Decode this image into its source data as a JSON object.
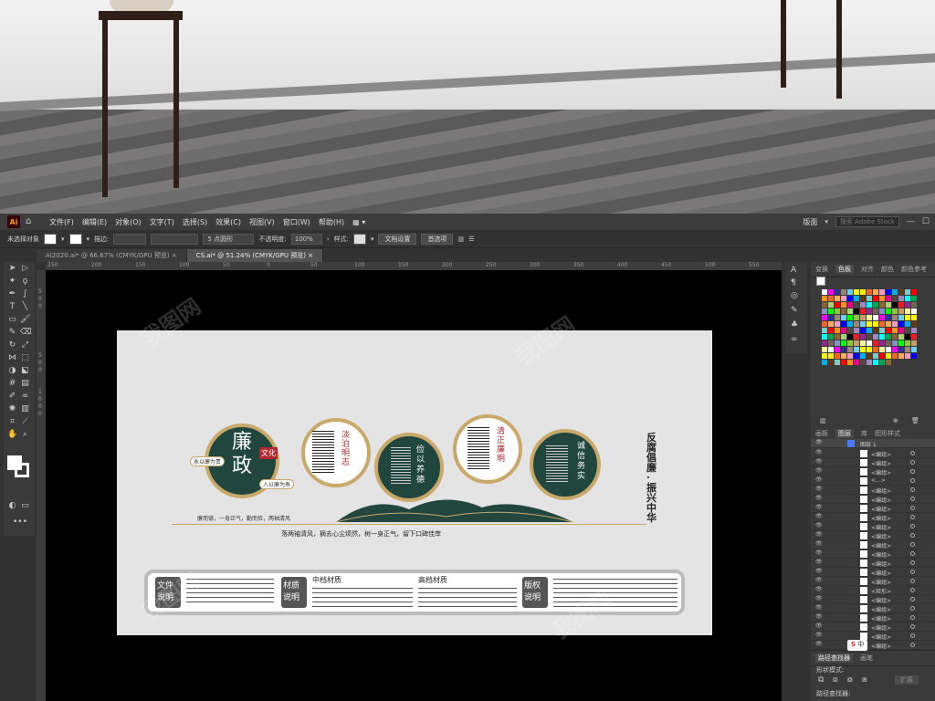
{
  "menubar": {
    "app_badge": "Ai",
    "items": [
      "文件(F)",
      "编辑(E)",
      "对象(O)",
      "文字(T)",
      "选择(S)",
      "效果(C)",
      "视图(V)",
      "窗口(W)",
      "帮助(H)"
    ],
    "workspace": "版面",
    "search_placeholder": "搜索 Adobe Stock"
  },
  "control": {
    "no_selection": "未选择对象",
    "stroke_label": "描边:",
    "brush_label": "5 点圆形",
    "opacity_label": "不透明度:",
    "opacity_value": "100%",
    "style_label": "样式:",
    "doc_setup": "文档设置",
    "preferences": "首选项"
  },
  "tabs": [
    {
      "label": "AI2020.ai* @ 66.67% (CMYK/GPU 预览)"
    },
    {
      "label": "CS.ai* @ 51.24% (CMYK/GPU 预览)"
    }
  ],
  "rulers": {
    "top": [
      "250",
      "200",
      "150",
      "100",
      "50",
      "0",
      "50",
      "100",
      "150",
      "200",
      "250",
      "300",
      "350",
      "400",
      "450",
      "500",
      "550"
    ],
    "left": [
      "5",
      "0",
      "0",
      "5",
      "0",
      "0",
      "1",
      "0",
      "0",
      "0"
    ]
  },
  "artwork": {
    "main_title": "廉政",
    "badge": "文化",
    "left_tag": "永以廉为贵",
    "right_tag": "人以廉为寿",
    "circles": [
      "淡泊明志",
      "俭以养德",
      "清正廉明",
      "诚信务实"
    ],
    "vertical_slogan": "反腐倡廉·振兴中华",
    "line1": "廉而德，一身正气，勤而俭，两袖清风",
    "line2": "落两袖清风，摘去心尘烦然，树一身正气，留下口碑佳岸",
    "bottom_sections": [
      {
        "title": "文件说明"
      },
      {
        "title": "材质说明"
      },
      {
        "title": "中档材质"
      },
      {
        "title": "高档材质"
      },
      {
        "title": "版权说明"
      }
    ]
  },
  "panels": {
    "swatch_tabs": [
      "变换",
      "色板",
      "对齐",
      "颜色",
      "颜色参考"
    ],
    "layer_tabs": [
      "画板",
      "图层",
      "库",
      "图形样式"
    ],
    "top_layer": "图层 1",
    "layer_rows": [
      "<编组>",
      "<编组>",
      "<编组>",
      "<...>",
      "<编组>",
      "<编组>",
      "<编组>",
      "<编组>",
      "<编组>",
      "<编组>",
      "<编组>",
      "<编组>",
      "<编组>",
      "<编组>",
      "<编组>",
      "<矩形>",
      "<编组>",
      "<编组>",
      "<编组>",
      "<编组>",
      "<编组>",
      "<编组>"
    ],
    "pathfinder_tabs": [
      "路径查找器",
      "画笔"
    ],
    "shape_mode": "形状模式:",
    "pathfinder_label": "路径查找器:",
    "expand": "扩展",
    "ime_label": "中"
  },
  "colors": {
    "accent": "#20463e",
    "gold": "#c9a96a",
    "red": "#b0272d"
  }
}
